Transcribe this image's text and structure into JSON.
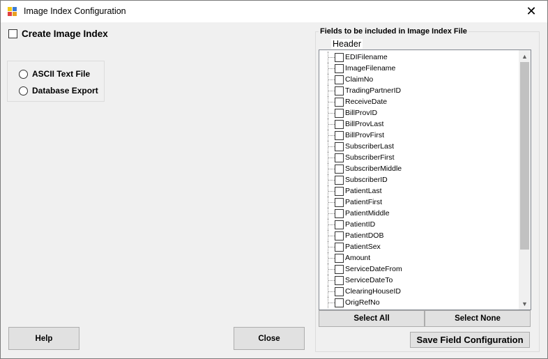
{
  "window": {
    "title": "Image Index Configuration"
  },
  "create_index": {
    "label": "Create Image Index"
  },
  "output_type": {
    "options": [
      {
        "label": "ASCII Text File"
      },
      {
        "label": "Database Export"
      }
    ]
  },
  "fields": {
    "group_label": "Fields to be included in Image Index File",
    "tree_root": "Header",
    "items": [
      "EDIFilename",
      "ImageFilename",
      "ClaimNo",
      "TradingPartnerID",
      "ReceiveDate",
      "BillProvID",
      "BillProvLast",
      "BillProvFirst",
      "SubscriberLast",
      "SubscriberFirst",
      "SubscriberMiddle",
      "SubscriberID",
      "PatientLast",
      "PatientFirst",
      "PatientMiddle",
      "PatientID",
      "PatientDOB",
      "PatientSex",
      "Amount",
      "ServiceDateFrom",
      "ServiceDateTo",
      "ClearingHouseID",
      "OrigRefNo"
    ]
  },
  "buttons": {
    "select_all": "Select All",
    "select_none": "Select None",
    "save_config": "Save Field Configuration",
    "help": "Help",
    "close": "Close"
  }
}
